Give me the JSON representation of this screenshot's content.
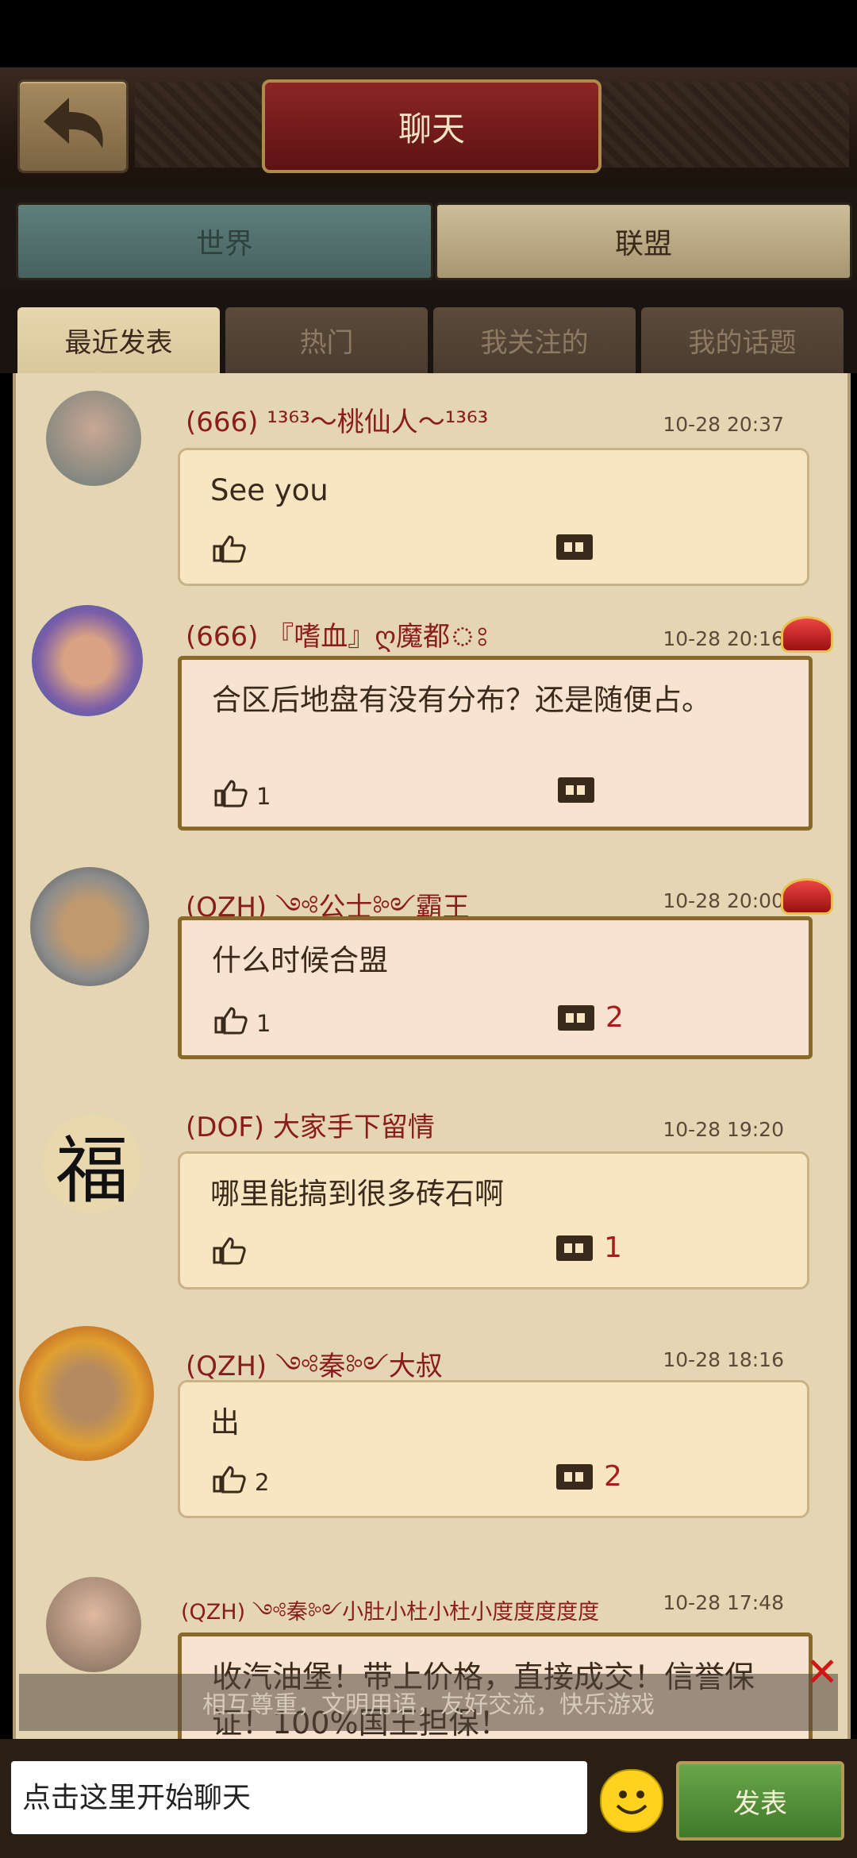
{
  "header": {
    "title": "聊天",
    "back_icon": "back-arrow-icon"
  },
  "main_tabs": [
    {
      "label": "世界",
      "active": false
    },
    {
      "label": "联盟",
      "active": true
    }
  ],
  "sub_tabs": [
    {
      "label": "最近发表",
      "active": true
    },
    {
      "label": "热门",
      "active": false
    },
    {
      "label": "我关注的",
      "active": false
    },
    {
      "label": "我的话题",
      "active": false
    }
  ],
  "posts": [
    {
      "user": "(666) ¹³⁶³～桃仙人～¹³⁶³",
      "time": "10-28 20:37",
      "text": "See you",
      "likes": "",
      "comments": "",
      "vip": false
    },
    {
      "user": "(666) 『嗜血』ღ魔都ঃ",
      "time": "10-28 20:16",
      "text": "合区后地盘有没有分布？还是随便占。",
      "likes": "1",
      "comments": "",
      "vip": true
    },
    {
      "user": "(QZH) ༺公士༻霸王",
      "time": "10-28 20:00",
      "text": "什么时候合盟",
      "likes": "1",
      "comments": "2",
      "vip": true
    },
    {
      "user": "(DOF) 大家手下留情",
      "time": "10-28 19:20",
      "text": "哪里能搞到很多砖石啊",
      "likes": "",
      "comments": "1",
      "vip": false
    },
    {
      "user": "(QZH) ༺秦༻大叔",
      "time": "10-28 18:16",
      "text": "出",
      "likes": "2",
      "comments": "2",
      "vip": false
    },
    {
      "user": "(QZH) ༺秦༻小肚小杜小杜小度度度度度",
      "time": "10-28 17:48",
      "text": "收汽油堡！带上价格，直接成交！信誉保证！100%国王担保！",
      "likes": "",
      "comments": "",
      "vip": true
    }
  ],
  "avatar_fu": "福",
  "notice": "相互尊重，文明用语，友好交流，快乐游戏",
  "input": {
    "placeholder": "点击这里开始聊天"
  },
  "send_label": "发表",
  "colors": {
    "username": "#8b1c1c",
    "bubble": "#f8e6c2",
    "send": "#4f8c35",
    "title_plate": "#7a1c1d"
  }
}
